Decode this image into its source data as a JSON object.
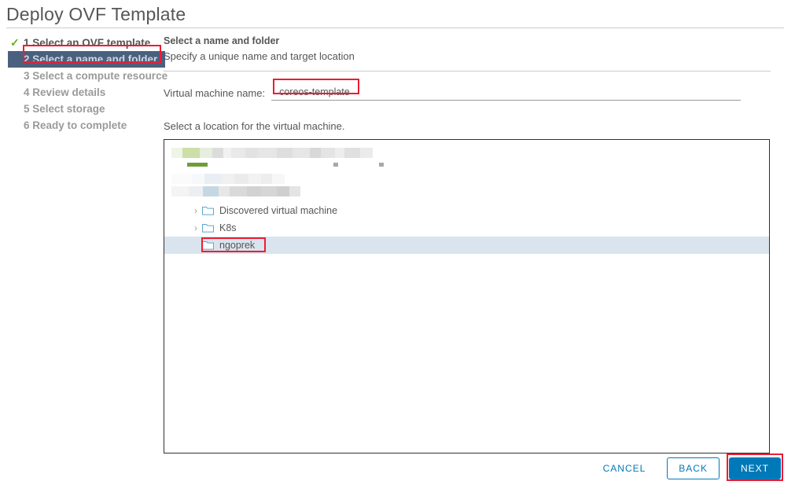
{
  "window": {
    "title": "Deploy OVF Template"
  },
  "steps": [
    {
      "number": "1",
      "label": "1 Select an OVF template",
      "state": "done"
    },
    {
      "number": "2",
      "label": "2 Select a name and folder",
      "state": "active"
    },
    {
      "number": "3",
      "label": "3 Select a compute resource",
      "state": "pending"
    },
    {
      "number": "4",
      "label": "4 Review details",
      "state": "pending"
    },
    {
      "number": "5",
      "label": "5 Select storage",
      "state": "pending"
    },
    {
      "number": "6",
      "label": "6 Ready to complete",
      "state": "pending"
    }
  ],
  "pane": {
    "title": "Select a name and folder",
    "subtitle": "Specify a unique name and target location",
    "vm_name_label": "Virtual machine name:",
    "vm_name_value": "coreos-template",
    "vm_name_placeholder": "Enter a name",
    "location_label": "Select a location for the virtual machine."
  },
  "tree": {
    "redacted_rows": 2,
    "items": [
      {
        "label": "Discovered virtual machine",
        "expandable": true,
        "selected": false,
        "icon": "folder-icon"
      },
      {
        "label": "K8s",
        "expandable": true,
        "selected": false,
        "icon": "folder-icon"
      },
      {
        "label": "ngoprek",
        "expandable": false,
        "selected": true,
        "icon": "folder-icon"
      }
    ]
  },
  "footer": {
    "cancel_label": "CANCEL",
    "back_label": "BACK",
    "next_label": "NEXT"
  },
  "colors": {
    "accent": "#0079b8",
    "active_step_bg": "#49617e",
    "check_green": "#60b515",
    "annotation_red": "#ed1c35",
    "selected_row": "#d9e4ee",
    "folder_blue": "#60a6d4"
  }
}
